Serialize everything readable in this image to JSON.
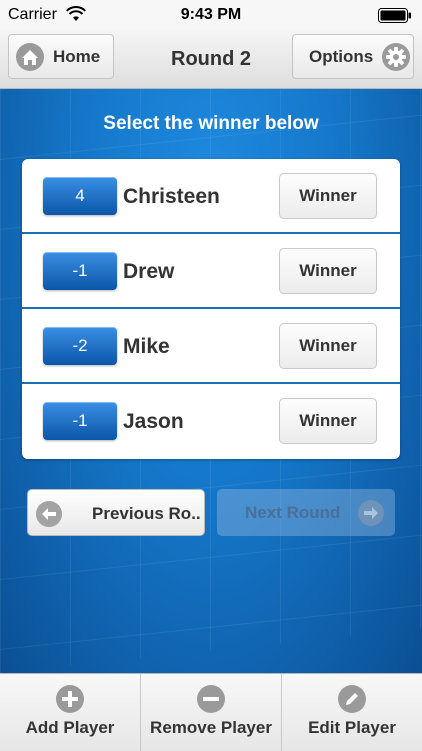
{
  "status_bar": {
    "carrier": "Carrier",
    "time": "9:43 PM"
  },
  "nav": {
    "home_label": "Home",
    "title": "Round 2",
    "options_label": "Options"
  },
  "subtitle": "Select the winner below",
  "players": [
    {
      "score": "4",
      "name": "Christeen",
      "action": "Winner"
    },
    {
      "score": "-1",
      "name": "Drew",
      "action": "Winner"
    },
    {
      "score": "-2",
      "name": "Mike",
      "action": "Winner"
    },
    {
      "score": "-1",
      "name": "Jason",
      "action": "Winner"
    }
  ],
  "round_nav": {
    "previous_label": "Previous Ro..",
    "next_label": "Next Round"
  },
  "tabs": [
    {
      "label": "Add Player",
      "icon": "plus-icon"
    },
    {
      "label": "Remove Player",
      "icon": "minus-icon"
    },
    {
      "label": "Edit Player",
      "icon": "pencil-icon"
    }
  ],
  "colors": {
    "accent_blue": "#1576c8",
    "badge_blue": "#0b56a8"
  }
}
